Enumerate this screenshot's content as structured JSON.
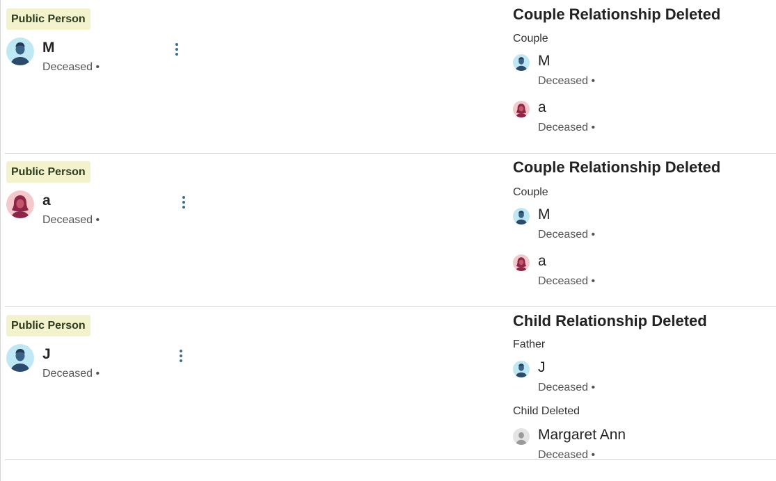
{
  "entries": [
    {
      "badge": "Public Person",
      "person": {
        "name": "M",
        "status": "Deceased •",
        "gender": "male"
      },
      "change": {
        "title": "Couple Relationship Deleted",
        "groups": [
          {
            "label": "Couple",
            "people": [
              {
                "name": "M",
                "status": "Deceased •",
                "gender": "male"
              },
              {
                "name": "a",
                "status": "Deceased •",
                "gender": "female"
              }
            ]
          }
        ]
      }
    },
    {
      "badge": "Public Person",
      "person": {
        "name": "a",
        "status": "Deceased •",
        "gender": "female"
      },
      "change": {
        "title": "Couple Relationship Deleted",
        "groups": [
          {
            "label": "Couple",
            "people": [
              {
                "name": "M",
                "status": "Deceased •",
                "gender": "male"
              },
              {
                "name": "a",
                "status": "Deceased •",
                "gender": "female"
              }
            ]
          }
        ]
      }
    },
    {
      "badge": "Public Person",
      "person": {
        "name": "J",
        "status": "Deceased •",
        "gender": "male"
      },
      "change": {
        "title": "Child Relationship Deleted",
        "groups": [
          {
            "label": "Father",
            "people": [
              {
                "name": "J",
                "status": "Deceased •",
                "gender": "male"
              }
            ]
          },
          {
            "label": "Child Deleted",
            "people": [
              {
                "name": "Margaret Ann",
                "status": "Deceased •",
                "gender": "unknown"
              }
            ]
          }
        ]
      }
    }
  ],
  "colors": {
    "badge_bg": "#f2f2cd",
    "male_bg": "#bfe8f5",
    "male_fg": "#3a6285",
    "female_bg": "#f5c9cc",
    "female_fg": "#8f2546",
    "unknown_bg": "#e4e4e4",
    "unknown_fg": "#9a9a9a",
    "kebab": "#3b6f8f"
  }
}
